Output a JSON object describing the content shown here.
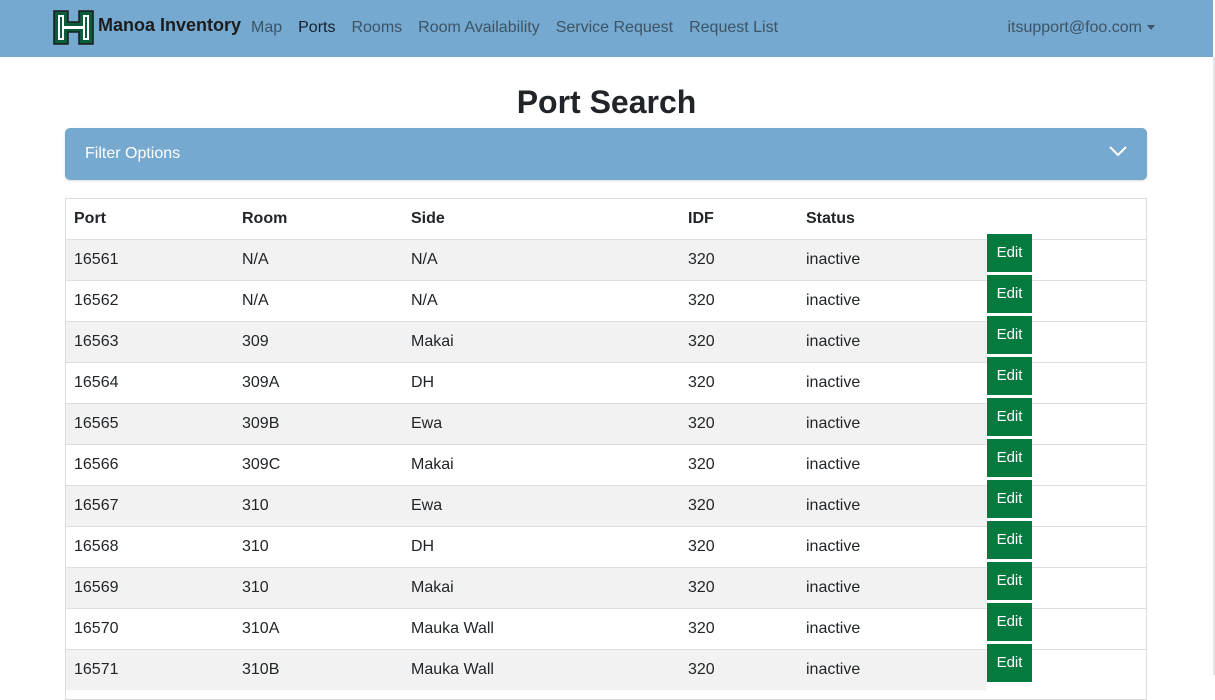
{
  "navbar": {
    "brand": "Manoa Inventory",
    "links": [
      "Map",
      "Ports",
      "Rooms",
      "Room Availability",
      "Service Request",
      "Request List"
    ],
    "active": "Ports",
    "user": "itsupport@foo.com"
  },
  "page": {
    "title": "Port Search"
  },
  "filter": {
    "label": "Filter Options"
  },
  "table": {
    "headers": [
      "Port",
      "Room",
      "Side",
      "IDF",
      "Status"
    ],
    "edit_label": "Edit",
    "rows": [
      [
        "16561",
        "N/A",
        "N/A",
        "320",
        "inactive"
      ],
      [
        "16562",
        "N/A",
        "N/A",
        "320",
        "inactive"
      ],
      [
        "16563",
        "309",
        "Makai",
        "320",
        "inactive"
      ],
      [
        "16564",
        "309A",
        "DH",
        "320",
        "inactive"
      ],
      [
        "16565",
        "309B",
        "Ewa",
        "320",
        "inactive"
      ],
      [
        "16566",
        "309C",
        "Makai",
        "320",
        "inactive"
      ],
      [
        "16567",
        "310",
        "Ewa",
        "320",
        "inactive"
      ],
      [
        "16568",
        "310",
        "DH",
        "320",
        "inactive"
      ],
      [
        "16569",
        "310",
        "Makai",
        "320",
        "inactive"
      ],
      [
        "16570",
        "310A",
        "Mauka Wall",
        "320",
        "inactive"
      ],
      [
        "16571",
        "310B",
        "Mauka Wall",
        "320",
        "inactive"
      ]
    ]
  },
  "colors": {
    "navbar": "#75a9cf",
    "edit_button": "#047a3e",
    "logo_green": "#0b5c3a"
  }
}
